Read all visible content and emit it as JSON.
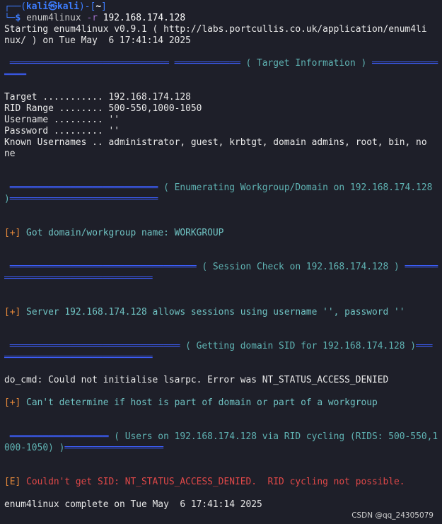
{
  "prompt": {
    "user": "kali",
    "host": "kali",
    "at_symbol": "㉿",
    "dir": "~",
    "command_name": "enum4linux",
    "command_flag": "-r",
    "command_arg": "192.168.174.128"
  },
  "output": {
    "start_1": "Starting enum4linux v0.9.1 ( http://labs.portcullis.co.uk/application/enum4li",
    "start_2": "nux/ ) on Tue May  6 17:41:14 2025",
    "hdr_target_info": "( Target Information )",
    "target_line": "Target ........... 192.168.174.128",
    "rid_line": "RID Range ........ 500-550,1000-1050",
    "username_line": "Username ......... ''",
    "password_line": "Password ......... ''",
    "known_users_1": "Known Usernames .. administrator, guest, krbtgt, domain admins, root, bin, no",
    "known_users_2": "ne",
    "hdr_workgroup": "( Enumerating Workgroup/Domain on 192.168.174.128",
    "hdr_workgroup_close": ")",
    "plus_tag": "[+]",
    "got_domain": " Got domain/workgroup name: WORKGROUP",
    "hdr_session": "( Session Check on 192.168.174.128 )",
    "server_allows": " Server 192.168.174.128 allows sessions using username '', password ''",
    "hdr_sid": "( Getting domain SID for 192.168.174.128 )",
    "do_cmd": "do_cmd: Could not initialise lsarpc. Error was NT_STATUS_ACCESS_DENIED",
    "cant_determine": " Can't determine if host is part of domain or part of a workgroup",
    "hdr_users_1": "( Users on 192.168.174.128 via RID cycling (RIDS: 500-550,1",
    "hdr_users_2": "000-1050) )",
    "error_tag": "[E]",
    "error_msg": " Couldn't get SID: NT_STATUS_ACCESS_DENIED.  RID cycling not possible.",
    "complete": "enum4linux complete on Tue May  6 17:41:14 2025"
  },
  "watermark": "CSDN @qq_24305079",
  "colors": {
    "background": "#1e1f29",
    "prompt_blue": "#3d7dff",
    "header_bar": "#3d5fff",
    "header_text": "#5fb3b3",
    "plus": "#e88a3a",
    "error": "#e04848"
  }
}
